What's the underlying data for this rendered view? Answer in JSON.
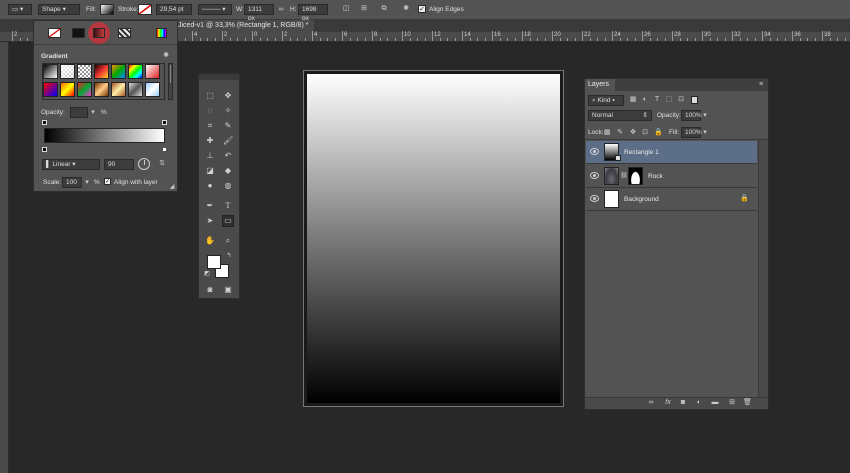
{
  "options_bar": {
    "mode": "Shape",
    "fill_label": "Fill:",
    "stroke_label": "Stroke:",
    "stroke_width": "29,54 pt",
    "w_label": "W:",
    "w_value": "1311 px",
    "h_label": "H:",
    "h_value": "1698 px",
    "align_edges": "Align Edges"
  },
  "document_tab": {
    "title": "Jiced-v1 @ 33,3% (Rectangle 1, RGB/8) *"
  },
  "ruler": {
    "labels": [
      "2",
      "14",
      "12",
      "10",
      "8",
      "6",
      "4",
      "2",
      "0",
      "2",
      "4",
      "6",
      "8",
      "10",
      "12",
      "14",
      "16",
      "18",
      "20",
      "22",
      "24",
      "26",
      "28",
      "30",
      "32",
      "34",
      "36",
      "38"
    ]
  },
  "gradient_popup": {
    "title": "Gradient",
    "opacity_label": "Opacity:",
    "opacity_unit": "%",
    "style": "Linear",
    "angle": "90",
    "scale_label": "Scale:",
    "scale_value": "100",
    "scale_unit": "%",
    "align_with_layer": "Align with layer"
  },
  "layers_panel": {
    "tab": "Layers",
    "filter_kind": "Kind",
    "blend_mode": "Normal",
    "opacity_label": "Opacity:",
    "opacity_value": "100%",
    "lock_label": "Lock:",
    "fill_label": "Fill:",
    "fill_value": "100%",
    "layers": [
      {
        "name": "Rectangle 1",
        "selected": true
      },
      {
        "name": "Rock",
        "selected": false
      },
      {
        "name": "Background",
        "selected": false
      }
    ],
    "footer_icons": [
      "link-icon",
      "fx-icon",
      "mask-icon",
      "adjustment-icon",
      "group-icon",
      "new-layer-icon",
      "trash-icon"
    ]
  },
  "colors": {
    "accent": "#5d6f88",
    "highlight": "#c8323c",
    "canvas_bg": "#282828"
  }
}
